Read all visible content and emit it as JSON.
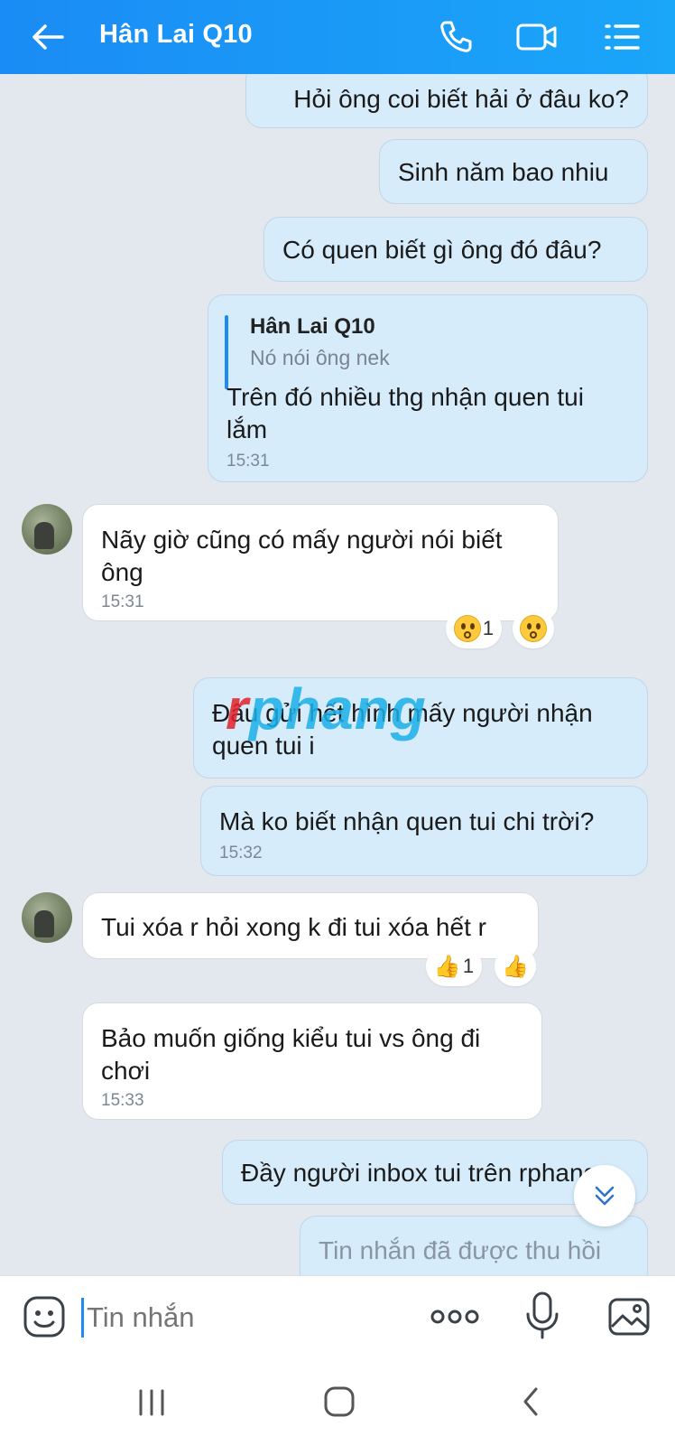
{
  "header": {
    "contact_name": "Hân Lai Q10",
    "icons": [
      "back-arrow-icon",
      "phone-icon",
      "video-call-icon",
      "menu-list-icon"
    ]
  },
  "messages": [
    {
      "dir": "out",
      "text": "Hỏi ông coi biết hải ở đâu ko?"
    },
    {
      "dir": "out",
      "text": "Sinh năm bao nhiu"
    },
    {
      "dir": "out",
      "text": "Có quen biết gì ông đó đâu?"
    },
    {
      "dir": "out",
      "quote_name": "Hân Lai Q10",
      "quote_text": "Nó nói ông nek",
      "line1": "Trên đó nhiều thg nhận quen tui",
      "line2": "lắm",
      "time": "15:31"
    },
    {
      "dir": "in",
      "line1": "Nãy giờ cũng có mấy người nói biết",
      "line2": "ông",
      "time": "15:31",
      "reaction_count": "1"
    },
    {
      "dir": "out",
      "line1": "Đâu gửi hết hình mấy người nhận",
      "line2": "quen tui i"
    },
    {
      "dir": "out",
      "text": "Mà ko biết nhận quen tui chi trời?",
      "time": "15:32"
    },
    {
      "dir": "in",
      "text": "Tui xóa r hỏi xong k đi tui xóa hết r",
      "reaction_count": "1"
    },
    {
      "dir": "in",
      "line1": "Bảo muốn giống kiểu tui vs ông đi",
      "line2": "chơi",
      "time": "15:33"
    },
    {
      "dir": "out",
      "text": "Đầy người inbox tui trên rphang"
    },
    {
      "dir": "out",
      "text": "Tin nhắn đã được thu hồi",
      "recalled": true
    }
  ],
  "watermark": {
    "first": "r",
    "rest": "phang"
  },
  "composer": {
    "placeholder": "Tin nhắn",
    "icons": [
      "sticker-icon",
      "more-dots-icon",
      "microphone-icon",
      "gallery-icon"
    ]
  },
  "colors": {
    "header": "#1a8cf5",
    "outgoing_bubble": "#d6ecfb",
    "incoming_bubble": "#ffffff",
    "background": "#e3e8ef"
  }
}
